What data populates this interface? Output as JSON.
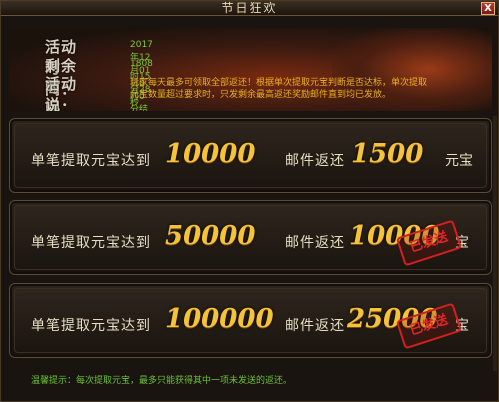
{
  "window": {
    "title": "节日狂欢",
    "close_label": "X"
  },
  "header": {
    "time_label": "活动时间：",
    "time_value": "2017年12月01日0时0分结束",
    "remaining_label": "剩余时间：",
    "remaining_value": "1808时15分28秒",
    "desc_label": "活动说明：",
    "desc_text": "玩家每天最多可领取全部返还！根据单次提取元宝判断是否达标，单次提取元宝数量超过要求时，只发剩余最高返还奖励邮件直到均已发放。"
  },
  "cards": [
    {
      "req_label": "单笔提取元宝达到",
      "req_amount": "10000",
      "mail_label": "邮件返还",
      "reward_amount": "1500",
      "unit": "元宝",
      "stamp": ""
    },
    {
      "req_label": "单笔提取元宝达到",
      "req_amount": "50000",
      "mail_label": "邮件返还",
      "reward_amount": "10000",
      "unit": "宝",
      "stamp": "已发送"
    },
    {
      "req_label": "单笔提取元宝达到",
      "req_amount": "100000",
      "mail_label": "邮件返还",
      "reward_amount": "25000",
      "unit": "宝",
      "stamp": "已发送"
    }
  ],
  "footer": {
    "tip": "温馨提示：每次提取元宝，最多只能获得其中一项未发送的返还。"
  }
}
